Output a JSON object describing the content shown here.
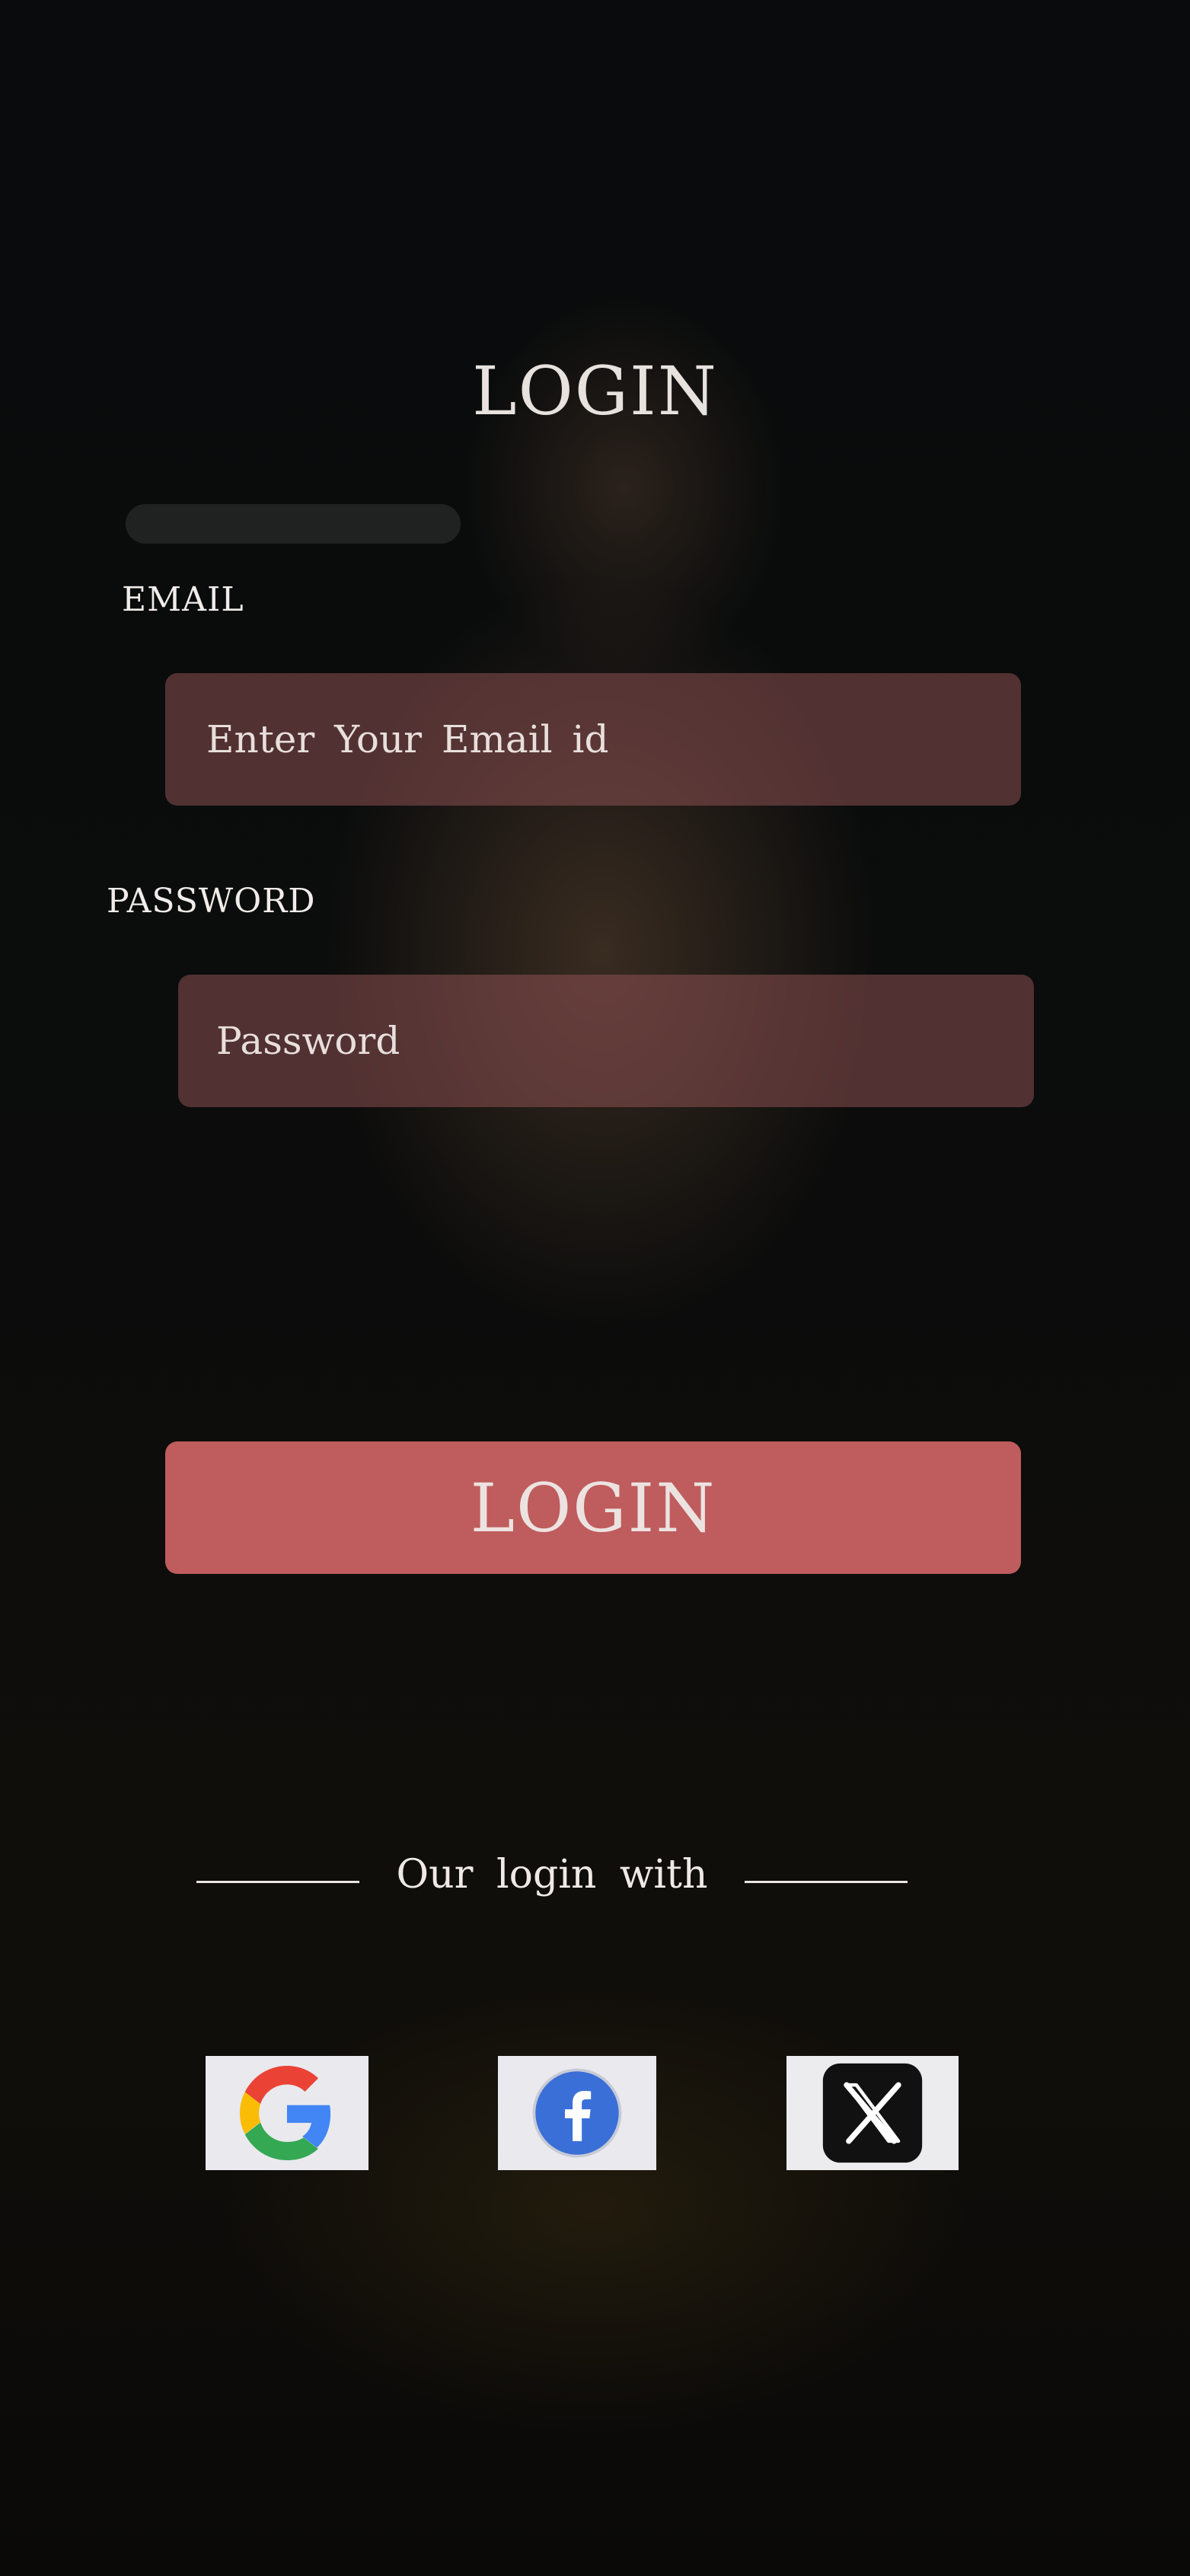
{
  "page": {
    "title": "LOGIN"
  },
  "form": {
    "email_label": "EMAIL",
    "email_placeholder": "Enter Your Email id",
    "email_value": "",
    "password_label": "PASSWORD",
    "password_placeholder": "Password",
    "password_value": "",
    "submit_label": "LOGIN"
  },
  "social_login": {
    "divider_text": "Our login with",
    "providers": [
      {
        "name": "Google",
        "icon": "google-icon"
      },
      {
        "name": "Facebook",
        "icon": "facebook-icon"
      },
      {
        "name": "X",
        "icon": "x-icon"
      }
    ]
  },
  "colors": {
    "input_background": "#8c5052",
    "button_background": "#e66e70",
    "text": "#e8e2df",
    "page_background": "#07090a"
  }
}
